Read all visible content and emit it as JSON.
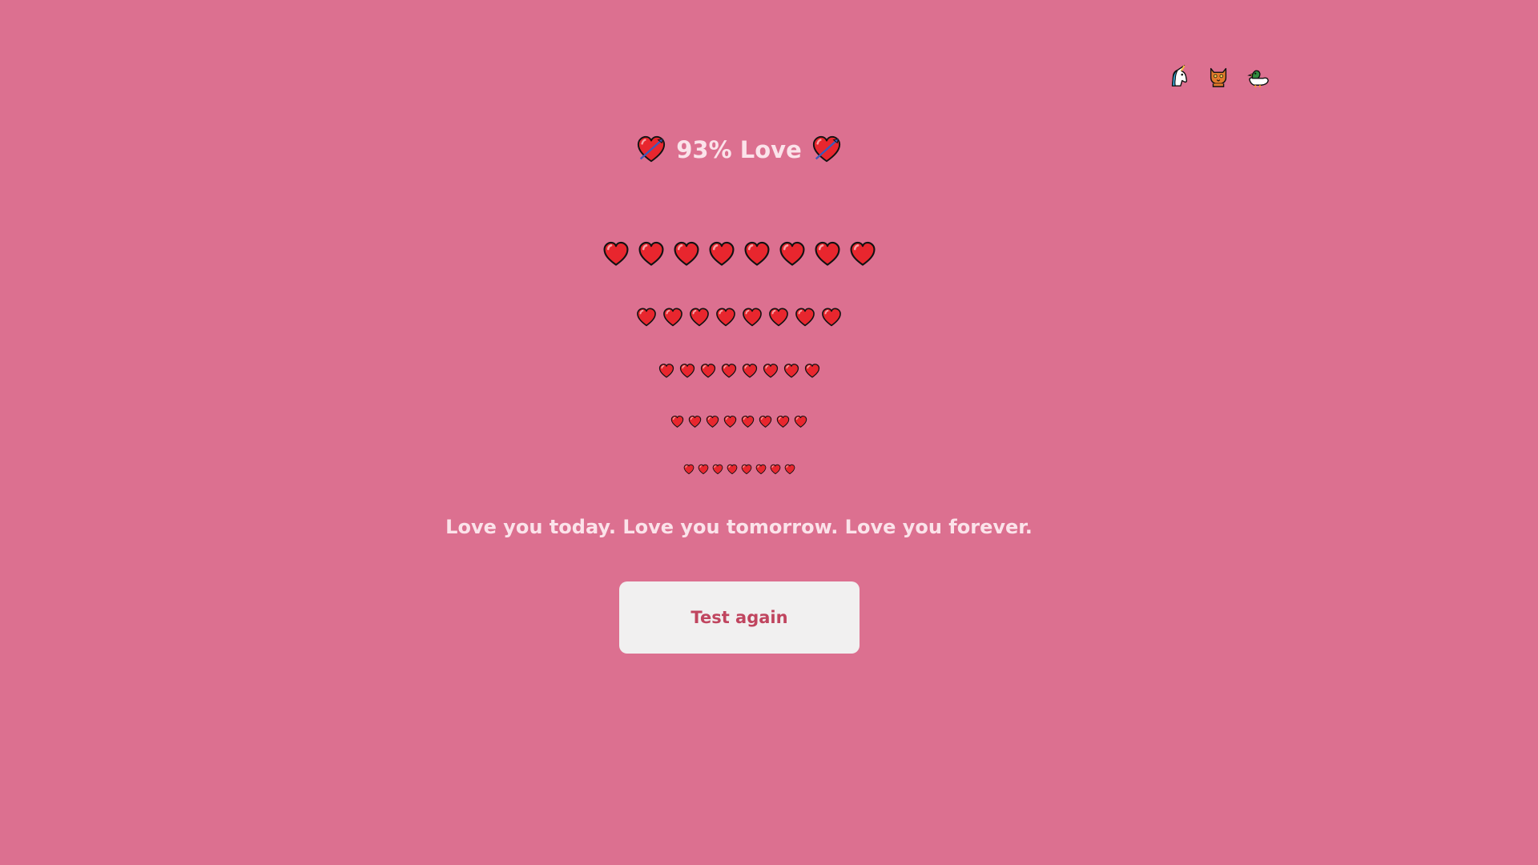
{
  "header": {
    "animals": [
      {
        "icon": "unicorn-icon"
      },
      {
        "icon": "cat-icon"
      },
      {
        "icon": "duck-icon"
      }
    ]
  },
  "result": {
    "title": "93% Love",
    "left_icon": "heart-with-arrow-icon",
    "right_icon": "heart-with-arrow-icon"
  },
  "hearts": {
    "icon": "red-heart-icon",
    "rows": [
      8,
      8,
      8,
      8,
      8
    ]
  },
  "message": "Love you today. Love you tomorrow. Love you forever.",
  "actions": {
    "test_again_label": "Test again"
  },
  "colors": {
    "background": "#dc7090",
    "text": "#fbe3ea",
    "button_bg": "#f1f0f0",
    "button_text": "#c0455f",
    "heart": "#e8262e"
  }
}
